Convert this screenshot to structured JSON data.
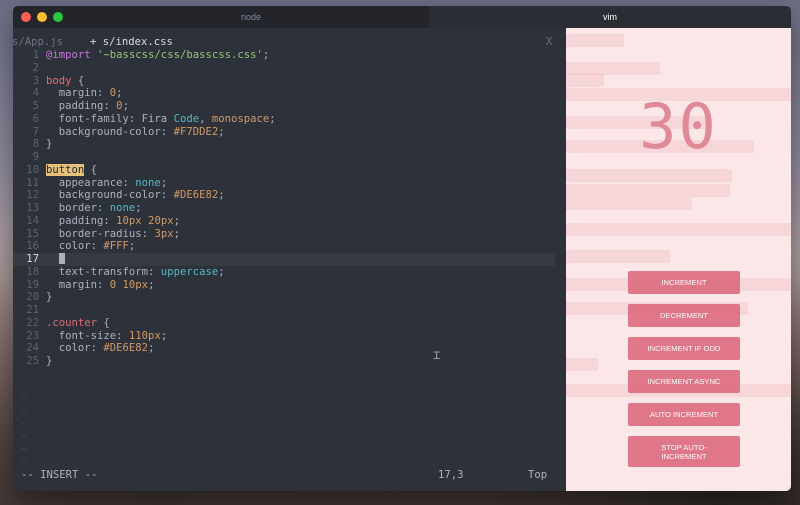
{
  "window": {
    "tabs": [
      {
        "label": "node",
        "active": false
      },
      {
        "label": "vim",
        "active": true
      }
    ]
  },
  "editor": {
    "file_tabs": {
      "inactive": "s/App.js",
      "current": " + s/index.css",
      "close": "X"
    },
    "current_line": 17,
    "lines": [
      {
        "n": "1",
        "tokens": [
          [
            "sel",
            "@import "
          ],
          [
            "str",
            "'~basscss/css/basscss.css'"
          ],
          [
            "plain",
            ";"
          ]
        ]
      },
      {
        "n": "2",
        "tokens": []
      },
      {
        "n": "3",
        "tokens": [
          [
            "tag",
            "body"
          ],
          [
            "plain",
            " {"
          ]
        ]
      },
      {
        "n": "4",
        "tokens": [
          [
            "prop",
            "  margin: "
          ],
          [
            "num",
            "0"
          ],
          [
            "plain",
            ";"
          ]
        ]
      },
      {
        "n": "5",
        "tokens": [
          [
            "prop",
            "  padding: "
          ],
          [
            "num",
            "0"
          ],
          [
            "plain",
            ";"
          ]
        ]
      },
      {
        "n": "6",
        "tokens": [
          [
            "prop",
            "  font-family: Fira "
          ],
          [
            "kw",
            "Code"
          ],
          [
            "plain",
            ", "
          ],
          [
            "num",
            "monospace"
          ],
          [
            "plain",
            ";"
          ]
        ]
      },
      {
        "n": "7",
        "tokens": [
          [
            "prop",
            "  background-color: "
          ],
          [
            "num",
            "#F7DDE2"
          ],
          [
            "plain",
            ";"
          ]
        ]
      },
      {
        "n": "8",
        "tokens": [
          [
            "plain",
            "}"
          ]
        ]
      },
      {
        "n": "9",
        "tokens": []
      },
      {
        "n": "10",
        "tokens": [
          [
            "hl-tag",
            "button"
          ],
          [
            "plain",
            " {"
          ]
        ]
      },
      {
        "n": "11",
        "tokens": [
          [
            "prop",
            "  appearance: "
          ],
          [
            "kw",
            "none"
          ],
          [
            "plain",
            ";"
          ]
        ]
      },
      {
        "n": "12",
        "tokens": [
          [
            "prop",
            "  background-color: "
          ],
          [
            "num",
            "#DE6E82"
          ],
          [
            "plain",
            ";"
          ]
        ]
      },
      {
        "n": "13",
        "tokens": [
          [
            "prop",
            "  border: "
          ],
          [
            "kw",
            "none"
          ],
          [
            "plain",
            ";"
          ]
        ]
      },
      {
        "n": "14",
        "tokens": [
          [
            "prop",
            "  padding: "
          ],
          [
            "num",
            "10px 20px"
          ],
          [
            "plain",
            ";"
          ]
        ]
      },
      {
        "n": "15",
        "tokens": [
          [
            "prop",
            "  border-radius: "
          ],
          [
            "num",
            "3px"
          ],
          [
            "plain",
            ";"
          ]
        ]
      },
      {
        "n": "16",
        "tokens": [
          [
            "prop",
            "  color: "
          ],
          [
            "num",
            "#FFF"
          ],
          [
            "plain",
            ";"
          ]
        ]
      },
      {
        "n": "17",
        "tokens": [
          [
            "plain",
            "  "
          ],
          [
            "cursor",
            ""
          ]
        ]
      },
      {
        "n": "18",
        "tokens": [
          [
            "prop",
            "  text-transform: "
          ],
          [
            "kw",
            "uppercase"
          ],
          [
            "plain",
            ";"
          ]
        ]
      },
      {
        "n": "19",
        "tokens": [
          [
            "prop",
            "  margin: "
          ],
          [
            "num",
            "0 10px"
          ],
          [
            "plain",
            ";"
          ]
        ]
      },
      {
        "n": "20",
        "tokens": [
          [
            "plain",
            "}"
          ]
        ]
      },
      {
        "n": "21",
        "tokens": []
      },
      {
        "n": "22",
        "tokens": [
          [
            "tag",
            ".counter"
          ],
          [
            "plain",
            " {"
          ]
        ]
      },
      {
        "n": "23",
        "tokens": [
          [
            "prop",
            "  font-size: "
          ],
          [
            "num",
            "110px"
          ],
          [
            "plain",
            ";"
          ]
        ]
      },
      {
        "n": "24",
        "tokens": [
          [
            "prop",
            "  color: "
          ],
          [
            "num",
            "#DE6E82"
          ],
          [
            "plain",
            ";"
          ]
        ]
      },
      {
        "n": "25",
        "tokens": [
          [
            "plain",
            "}"
          ]
        ]
      }
    ],
    "tildes": [
      "~",
      "~",
      "~",
      "~",
      "~",
      "~"
    ],
    "status": {
      "mode": "-- INSERT --",
      "position": "17,3",
      "scroll": "Top"
    }
  },
  "app": {
    "counter": "30",
    "colors": {
      "background": "#F7DDE2",
      "button": "#DE6E82",
      "text": "#FFF"
    },
    "buttons": [
      {
        "label": "Increment",
        "name": "increment-button"
      },
      {
        "label": "Decrement",
        "name": "decrement-button"
      },
      {
        "label": "Increment if odd",
        "name": "increment-if-odd-button"
      },
      {
        "label": "Increment async",
        "name": "increment-async-button"
      },
      {
        "label": "Auto increment",
        "name": "auto-increment-button"
      },
      {
        "label": "Stop auto-increment",
        "name": "stop-auto-increment-button"
      }
    ]
  }
}
